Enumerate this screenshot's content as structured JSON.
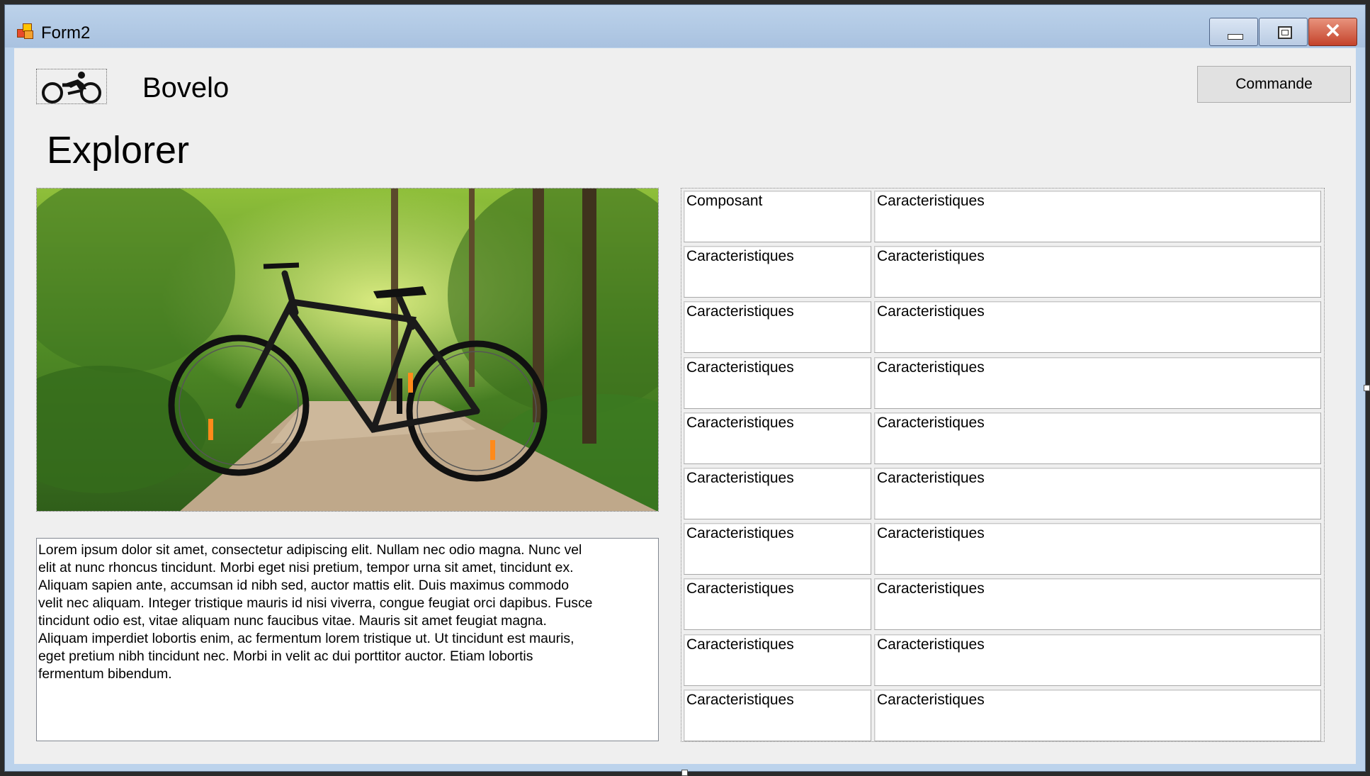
{
  "window": {
    "title": "Form2",
    "controls": {
      "minimize": "minimize",
      "maximize": "maximize",
      "close": "close"
    }
  },
  "header": {
    "brand": "Bovelo",
    "logo_icon": "cyclist-icon",
    "command_button": "Commande"
  },
  "main": {
    "heading": "Explorer",
    "image_subject": "bicycle on forest path",
    "description": "Lorem ipsum dolor sit amet, consectetur adipiscing elit. Nullam nec odio magna. Nunc vel\nelit at nunc rhoncus tincidunt. Morbi eget nisi pretium, tempor urna sit amet, tincidunt ex.\nAliquam sapien ante, accumsan id nibh sed, auctor mattis elit. Duis maximus commodo\nvelit nec aliquam. Integer tristique mauris id nisi viverra, congue feugiat orci dapibus. Fusce\ntincidunt odio est, vitae aliquam nunc faucibus vitae. Mauris sit amet feugiat magna.\nAliquam imperdiet lobortis enim, ac fermentum lorem tristique ut. Ut tincidunt est mauris,\neget pretium nibh tincidunt nec. Morbi in velit ac dui porttitor auctor. Etiam lobortis\nfermentum bibendum."
  },
  "table": {
    "rows": [
      [
        "Composant",
        "Caracteristiques"
      ],
      [
        "Caracteristiques",
        "Caracteristiques"
      ],
      [
        "Caracteristiques",
        "Caracteristiques"
      ],
      [
        "Caracteristiques",
        "Caracteristiques"
      ],
      [
        "Caracteristiques",
        "Caracteristiques"
      ],
      [
        "Caracteristiques",
        "Caracteristiques"
      ],
      [
        "Caracteristiques",
        "Caracteristiques"
      ],
      [
        "Caracteristiques",
        "Caracteristiques"
      ],
      [
        "Caracteristiques",
        "Caracteristiques"
      ],
      [
        "Caracteristiques",
        "Caracteristiques"
      ]
    ]
  },
  "colors": {
    "titlebar": "#b4cbe6",
    "client_background": "#efefef",
    "close_button": "#c4432b"
  }
}
